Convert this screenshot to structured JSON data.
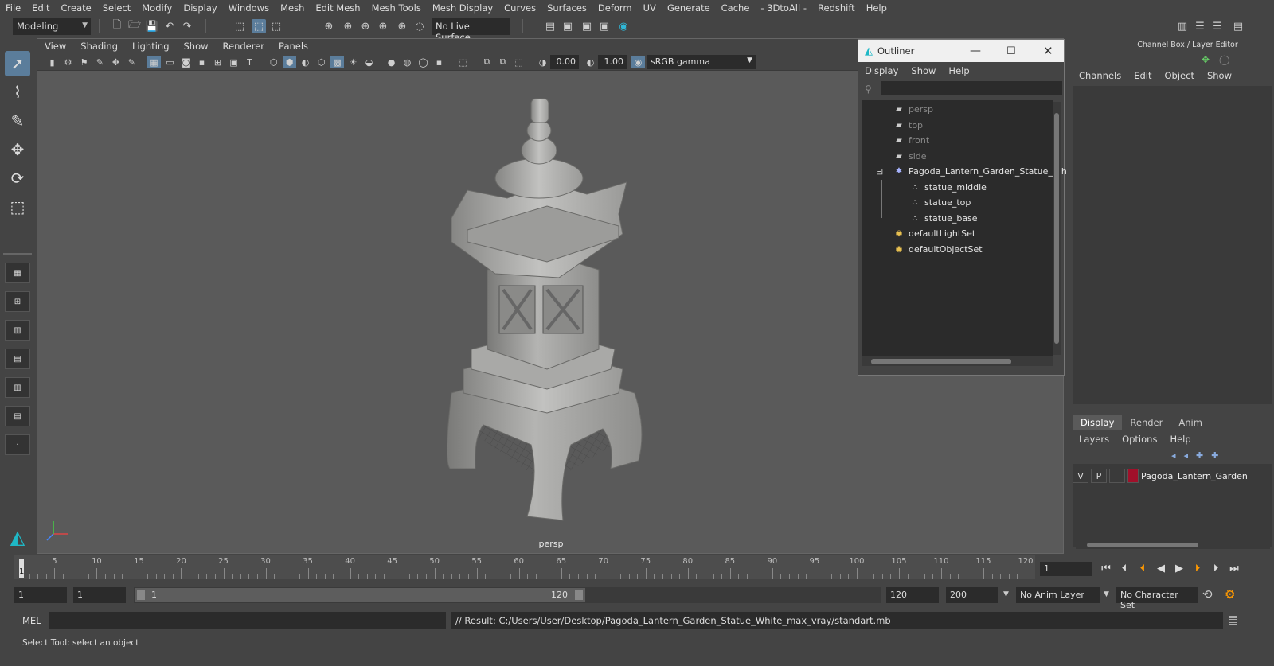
{
  "menubar": [
    "File",
    "Edit",
    "Create",
    "Select",
    "Modify",
    "Display",
    "Windows",
    "Mesh",
    "Edit Mesh",
    "Mesh Tools",
    "Mesh Display",
    "Curves",
    "Surfaces",
    "Deform",
    "UV",
    "Generate",
    "Cache",
    "- 3DtoAll -",
    "Redshift",
    "Help"
  ],
  "shelf": {
    "mode": "Modeling",
    "live_surface": "No Live Surface"
  },
  "viewport": {
    "menu": [
      "View",
      "Shading",
      "Lighting",
      "Show",
      "Renderer",
      "Panels"
    ],
    "exposure": "0.00",
    "gamma": "1.00",
    "color_space": "sRGB gamma",
    "camera_label": "persp"
  },
  "outliner": {
    "title": "Outliner",
    "menu": [
      "Display",
      "Show",
      "Help"
    ],
    "items": [
      {
        "label": "persp",
        "type": "camera",
        "indent": 0,
        "dim": true
      },
      {
        "label": "top",
        "type": "camera",
        "indent": 0,
        "dim": true
      },
      {
        "label": "front",
        "type": "camera",
        "indent": 0,
        "dim": true
      },
      {
        "label": "side",
        "type": "camera",
        "indent": 0,
        "dim": true
      },
      {
        "label": "Pagoda_Lantern_Garden_Statue_Wh",
        "type": "group",
        "indent": 0,
        "dim": false
      },
      {
        "label": "statue_middle",
        "type": "mesh",
        "indent": 1,
        "dim": false
      },
      {
        "label": "statue_top",
        "type": "mesh",
        "indent": 1,
        "dim": false
      },
      {
        "label": "statue_base",
        "type": "mesh",
        "indent": 1,
        "dim": false
      },
      {
        "label": "defaultLightSet",
        "type": "set",
        "indent": 0,
        "dim": false
      },
      {
        "label": "defaultObjectSet",
        "type": "set",
        "indent": 0,
        "dim": false
      }
    ]
  },
  "channel_box": {
    "title": "Channel Box / Layer Editor",
    "menu": [
      "Channels",
      "Edit",
      "Object",
      "Show"
    ],
    "tabs": [
      "Display",
      "Render",
      "Anim"
    ],
    "layer_menu": [
      "Layers",
      "Options",
      "Help"
    ],
    "layer": {
      "v": "V",
      "p": "P",
      "name": "Pagoda_Lantern_Garden",
      "color": "#a0102a"
    }
  },
  "timeline": {
    "labels": [
      "5",
      "10",
      "15",
      "20",
      "25",
      "30",
      "35",
      "40",
      "45",
      "50",
      "55",
      "60",
      "65",
      "70",
      "75",
      "80",
      "85",
      "90",
      "95",
      "100",
      "105",
      "110",
      "115",
      "120"
    ],
    "start_marker": "1",
    "current_frame": "1"
  },
  "range": {
    "start": "1",
    "anim_start": "1",
    "slider_start": "1",
    "slider_end": "120",
    "anim_end": "120",
    "end": "200",
    "anim_layer": "No Anim Layer",
    "character_set": "No Character Set"
  },
  "command": {
    "lang": "MEL",
    "result": "// Result: C:/Users/User/Desktop/Pagoda_Lantern_Garden_Statue_White_max_vray/standart.mb"
  },
  "status": "Select Tool: select an object"
}
